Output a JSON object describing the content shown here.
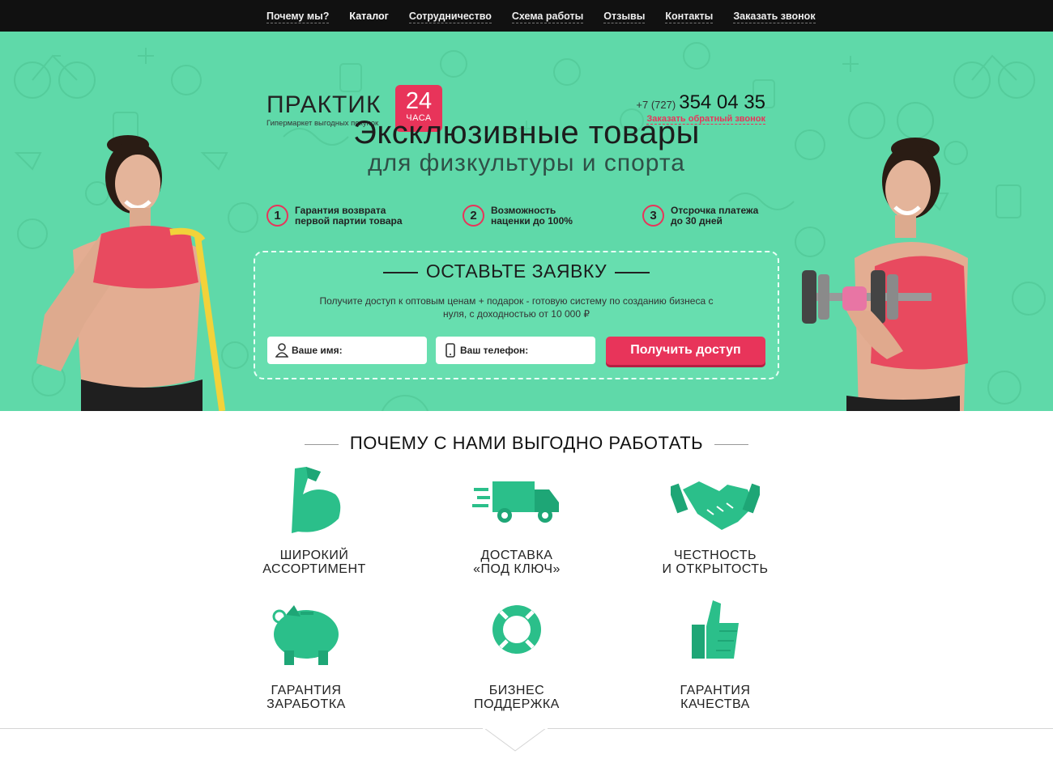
{
  "nav": {
    "items": [
      "Почему мы?",
      "Каталог",
      "Сотрудничество",
      "Схема работы",
      "Отзывы",
      "Контакты",
      "Заказать звонок"
    ],
    "active": "Каталог"
  },
  "logo": {
    "name": "ПРАКТИК",
    "subtitle": "Гипермаркет выгодных покупок",
    "badge_num": "24",
    "badge_text": "ЧАСА"
  },
  "contact": {
    "code": "+7 (727)",
    "phone": "354 04 35",
    "callback": "Заказать обратный звонок"
  },
  "hero": {
    "title": "Эксклюзивные товары",
    "subtitle": "для физкультуры и спорта",
    "features": [
      {
        "num": "1",
        "line1": "Гарантия возврата",
        "line2": "первой партии товара"
      },
      {
        "num": "2",
        "line1": "Возможность",
        "line2": "наценки до 100%"
      },
      {
        "num": "3",
        "line1": "Отсрочка платежа",
        "line2": "до 30 дней"
      }
    ]
  },
  "form": {
    "title": "ОСТАВЬТЕ ЗАЯВКУ",
    "description": "Получите доступ к оптовым ценам + подарок - готовую систему по созданию бизнеса с нуля, с доходностью от 10 000 ₽",
    "name_placeholder": "Ваше имя:",
    "phone_placeholder": "Ваш телефон:",
    "submit": "Получить доступ"
  },
  "why": {
    "title": "ПОЧЕМУ С НАМИ ВЫГОДНО РАБОТАТЬ",
    "cards": [
      {
        "icon": "bicep-icon",
        "line1": "ШИРОКИЙ",
        "line2": "АССОРТИМЕНТ"
      },
      {
        "icon": "truck-icon",
        "line1": "ДОСТАВКА",
        "line2": "«ПОД КЛЮЧ»"
      },
      {
        "icon": "handshake-icon",
        "line1": "ЧЕСТНОСТЬ",
        "line2": "И ОТКРЫТОСТЬ"
      },
      {
        "icon": "piggy-bank-icon",
        "line1": "ГАРАНТИЯ",
        "line2": "ЗАРАБОТКА"
      },
      {
        "icon": "lifebuoy-icon",
        "line1": "БИЗНЕС",
        "line2": "ПОДДЕРЖКА"
      },
      {
        "icon": "thumbs-up-icon",
        "line1": "ГАРАНТИЯ",
        "line2": "КАЧЕСТВА"
      }
    ]
  },
  "colors": {
    "accent": "#e8345a",
    "hero_bg": "#5fd9a9",
    "icon_green": "#2bbf8a",
    "nav_bg": "#111111"
  }
}
